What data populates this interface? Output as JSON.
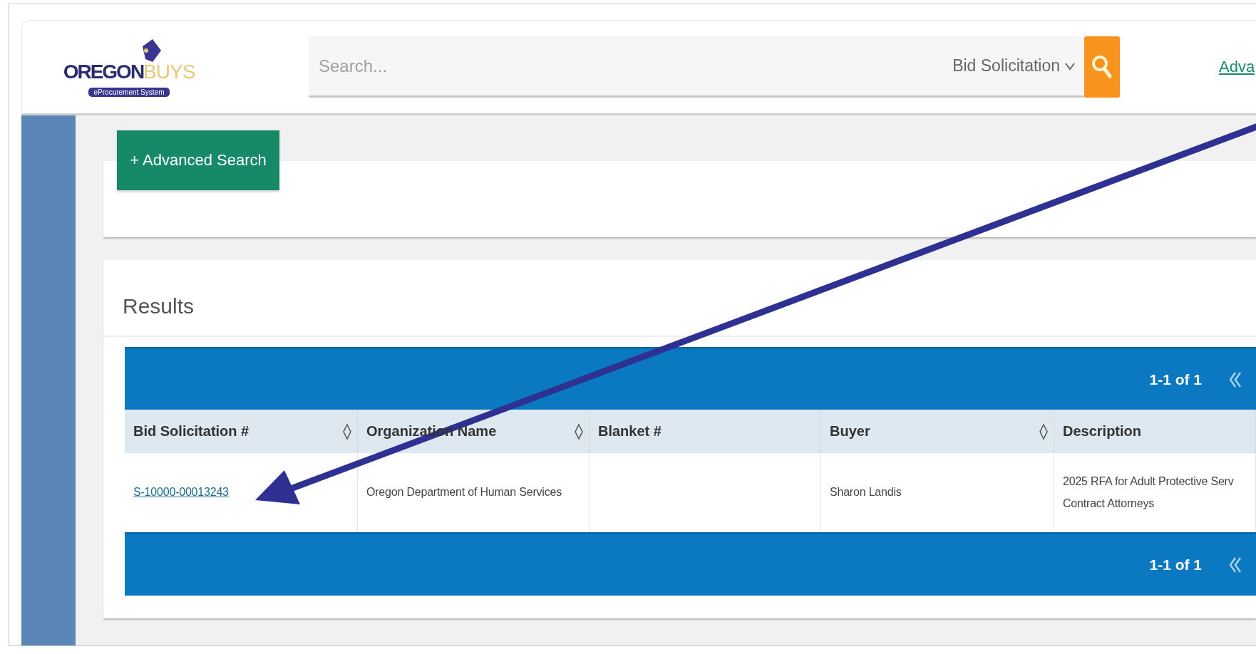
{
  "logo": {
    "word_1": "OREGON",
    "word_2": "BUYS",
    "tagline": "eProcurement System"
  },
  "search": {
    "placeholder": "Search...",
    "scope": "Bid Solicitation"
  },
  "header_link": "Adva",
  "advanced_search_button": "+ Advanced Search",
  "results": {
    "title": "Results",
    "pagination_top": "1-1 of 1",
    "pagination_bottom": "1-1 of 1",
    "columns": [
      {
        "label": "Bid Solicitation #",
        "sortable": true
      },
      {
        "label": "Organization Name",
        "sortable": true
      },
      {
        "label": "Blanket #",
        "sortable": false
      },
      {
        "label": "Buyer",
        "sortable": true
      },
      {
        "label": "Description",
        "sortable": false
      }
    ],
    "rows": [
      {
        "cells": [
          {
            "kind": "link",
            "text": "S-10000-00013243"
          },
          {
            "kind": "text",
            "text": "Oregon Department of Human Services"
          },
          {
            "kind": "blank"
          },
          {
            "kind": "text",
            "text": "Sharon Landis"
          },
          {
            "kind": "text",
            "text": "2025 RFA for Adult Protective Serv\nContract Attorneys"
          }
        ]
      }
    ]
  }
}
